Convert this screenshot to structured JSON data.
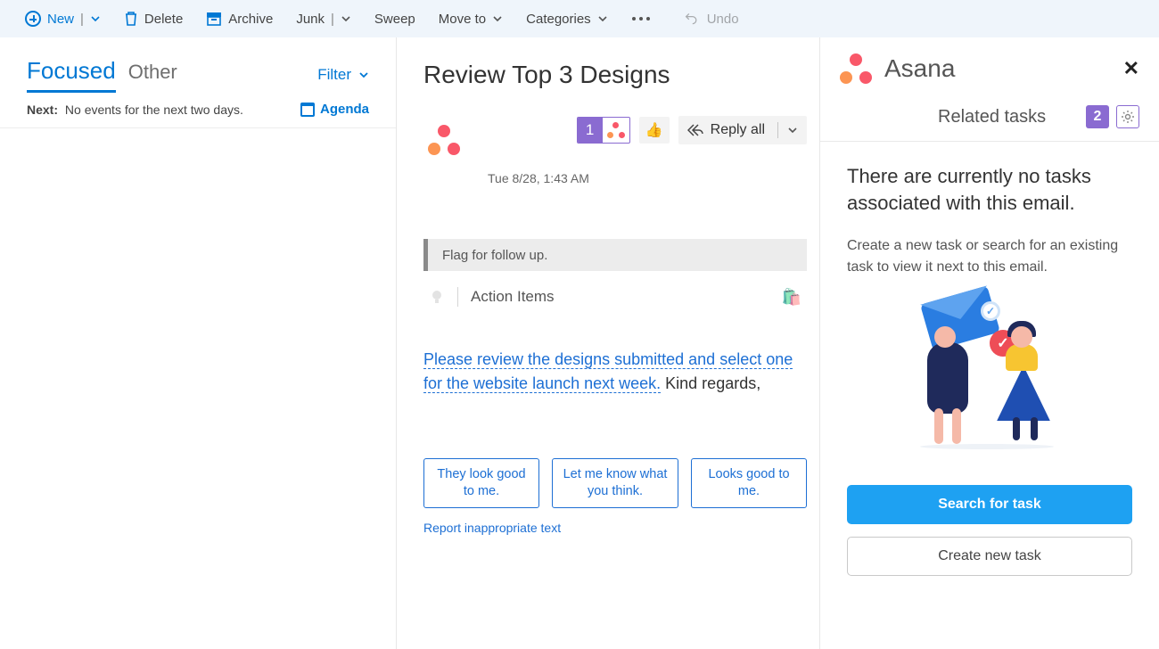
{
  "toolbar": {
    "new": "New",
    "delete": "Delete",
    "archive": "Archive",
    "junk": "Junk",
    "sweep": "Sweep",
    "move_to": "Move to",
    "categories": "Categories",
    "undo": "Undo"
  },
  "list": {
    "tab_focused": "Focused",
    "tab_other": "Other",
    "filter": "Filter",
    "next_label": "Next:",
    "next_text": "No events for the next two days.",
    "agenda": "Agenda"
  },
  "message": {
    "subject": "Review Top 3 Designs",
    "timestamp": "Tue 8/28, 1:43 AM",
    "badge_count": "1",
    "reply_all": "Reply all",
    "flag_text": "Flag for follow up.",
    "action_items": "Action Items",
    "body_link": "Please review the designs submitted and select one for the website launch next week.",
    "body_tail": " Kind regards,",
    "suggestions": [
      "They look good to me.",
      "Let me know what you think.",
      "Looks good to me."
    ],
    "report": "Report inappropriate text"
  },
  "asana": {
    "brand": "Asana",
    "related_title": "Related tasks",
    "count": "2",
    "headline": "There are currently no tasks associated with this email.",
    "sub": "Create a new task or search for an existing task to view it next to this email.",
    "search_btn": "Search for task",
    "create_btn": "Create new task"
  }
}
